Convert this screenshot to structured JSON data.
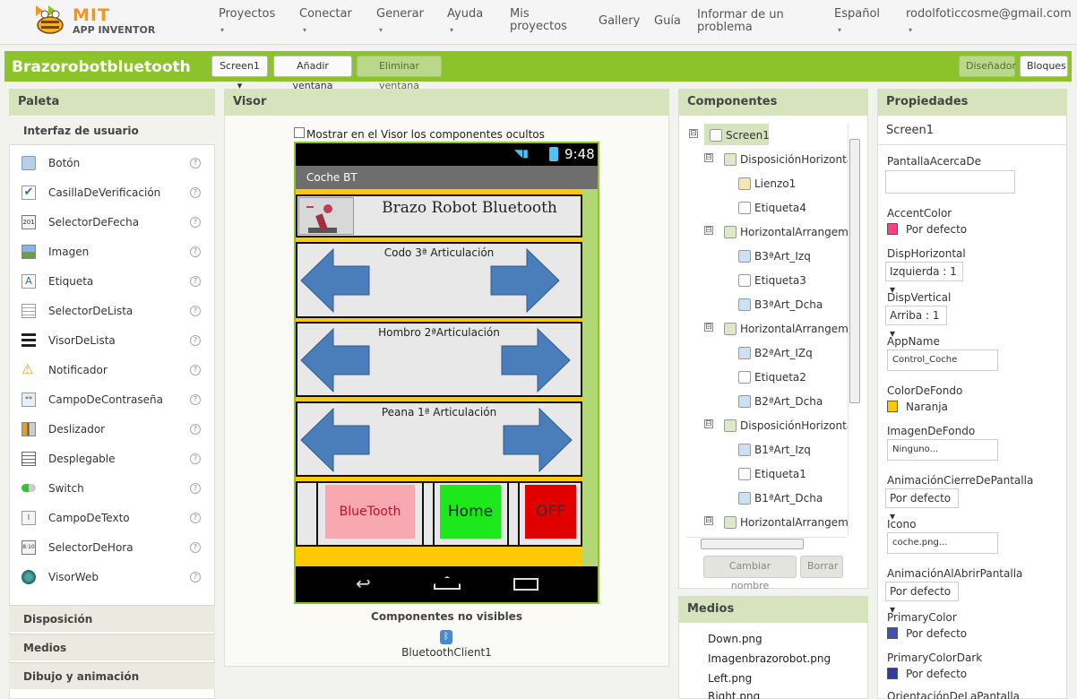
{
  "topnav": {
    "logo_main": "MIT",
    "logo_sub": "APP INVENTOR",
    "items": [
      {
        "label": "Proyectos",
        "caret": "▾"
      },
      {
        "label": "Conectar",
        "caret": "▾"
      },
      {
        "label": "Generar",
        "caret": "▾"
      },
      {
        "label": "Ayuda",
        "caret": "▾"
      },
      {
        "label": "Mis proyectos"
      },
      {
        "label": "Gallery"
      },
      {
        "label": "Guía"
      },
      {
        "label": "Informar de un problema"
      },
      {
        "label": "Español",
        "caret": "▾"
      },
      {
        "label": "rodolfoticcosme@gmail.com",
        "caret": "▾"
      }
    ]
  },
  "toolbar": {
    "project_name": "Brazorobotbluetooth",
    "screen_select": "Screen1 ▾",
    "add_screen": "Añadir ventana",
    "remove_screen": "Eliminar ventana",
    "designer": "Diseñador",
    "blocks": "Bloques"
  },
  "palette": {
    "title": "Paleta",
    "category": "Interfaz de usuario",
    "items": [
      {
        "label": "Botón",
        "icon": "button-icon"
      },
      {
        "label": "CasillaDeVerificación",
        "icon": "checkbox-icon"
      },
      {
        "label": "SelectorDeFecha",
        "icon": "datepicker-icon"
      },
      {
        "label": "Imagen",
        "icon": "image-icon"
      },
      {
        "label": "Etiqueta",
        "icon": "label-icon"
      },
      {
        "label": "SelectorDeLista",
        "icon": "listpicker-icon"
      },
      {
        "label": "VisorDeLista",
        "icon": "listview-icon"
      },
      {
        "label": "Notificador",
        "icon": "notifier-icon"
      },
      {
        "label": "CampoDeContraseña",
        "icon": "password-icon"
      },
      {
        "label": "Deslizador",
        "icon": "slider-icon"
      },
      {
        "label": "Desplegable",
        "icon": "spinner-icon"
      },
      {
        "label": "Switch",
        "icon": "switch-icon"
      },
      {
        "label": "CampoDeTexto",
        "icon": "textbox-icon"
      },
      {
        "label": "SelectorDeHora",
        "icon": "timepicker-icon"
      },
      {
        "label": "VisorWeb",
        "icon": "webviewer-icon"
      }
    ],
    "help_glyph": "?",
    "sections": [
      "Disposición",
      "Medios",
      "Dibujo y animación"
    ]
  },
  "viewer": {
    "title": "Visor",
    "show_hidden": "Mostrar en el Visor los componentes ocultos",
    "time": "9:48",
    "app_title": "Coche BT",
    "header_text": "Brazo Robot Bluetooth",
    "row1": "Codo 3ª Articulación",
    "row2": "Hombro 2ªArticulación",
    "row3": "Peana 1ª Articulación",
    "btn_bt": "BlueTooth",
    "btn_home": "Home",
    "btn_off": "OFF",
    "nonvisible_title": "Componentes no visibles",
    "nonvisible_item": "BluetoothClient1"
  },
  "components": {
    "title": "Componentes",
    "tree": [
      {
        "label": "Screen1",
        "toggle": "⊟"
      },
      {
        "label": "DisposiciónHorizontal",
        "toggle": "⊟"
      },
      {
        "label": "Lienzo1"
      },
      {
        "label": "Etiqueta4"
      },
      {
        "label": "HorizontalArrangemen",
        "toggle": "⊟"
      },
      {
        "label": "B3ªArt_Izq"
      },
      {
        "label": "Etiqueta3"
      },
      {
        "label": "B3ªArt_Dcha"
      },
      {
        "label": "HorizontalArrangemen",
        "toggle": "⊟"
      },
      {
        "label": "B2ªArt_IZq"
      },
      {
        "label": "Etiqueta2"
      },
      {
        "label": "B2ªArt_Dcha"
      },
      {
        "label": "DisposiciónHorizontal",
        "toggle": "⊟"
      },
      {
        "label": "B1ªArt_Izq"
      },
      {
        "label": "Etiqueta1"
      },
      {
        "label": "B1ªArt_Dcha"
      },
      {
        "label": "HorizontalArrangemen",
        "toggle": "⊟"
      }
    ],
    "rename": "Cambiar nombre",
    "delete": "Borrar"
  },
  "media": {
    "title": "Medios",
    "files": [
      "Down.png",
      "Imagenbrazorobot.png",
      "Left.png",
      "Right.png"
    ]
  },
  "properties": {
    "title": "Propiedades",
    "component": "Screen1",
    "about": {
      "label": "PantallaAcercaDe",
      "value": ""
    },
    "accent": {
      "label": "AccentColor",
      "value": "Por defecto",
      "color": "#ff4081"
    },
    "halign": {
      "label": "DispHorizontal",
      "value": "Izquierda : 1 ▾"
    },
    "valign": {
      "label": "DispVertical",
      "value": "Arriba : 1 ▾"
    },
    "appname": {
      "label": "AppName",
      "value": "Control_Coche"
    },
    "bg": {
      "label": "ColorDeFondo",
      "value": "Naranja",
      "color": "#ffc800"
    },
    "bgimage": {
      "label": "ImagenDeFondo",
      "value": "Ninguno..."
    },
    "closeanim": {
      "label": "AnimaciónCierreDePantalla",
      "value": "Por defecto ▾"
    },
    "icon": {
      "label": "Icono",
      "value": "coche.png..."
    },
    "openanim": {
      "label": "AnimaciónAlAbrirPantalla",
      "value": "Por defecto ▾"
    },
    "primary": {
      "label": "PrimaryColor",
      "value": "Por defecto",
      "color": "#3f51b5"
    },
    "primarydark": {
      "label": "PrimaryColorDark",
      "value": "Por defecto",
      "color": "#303f9f"
    },
    "orientation": {
      "label": "OrientaciónDeLaPantalla"
    }
  }
}
